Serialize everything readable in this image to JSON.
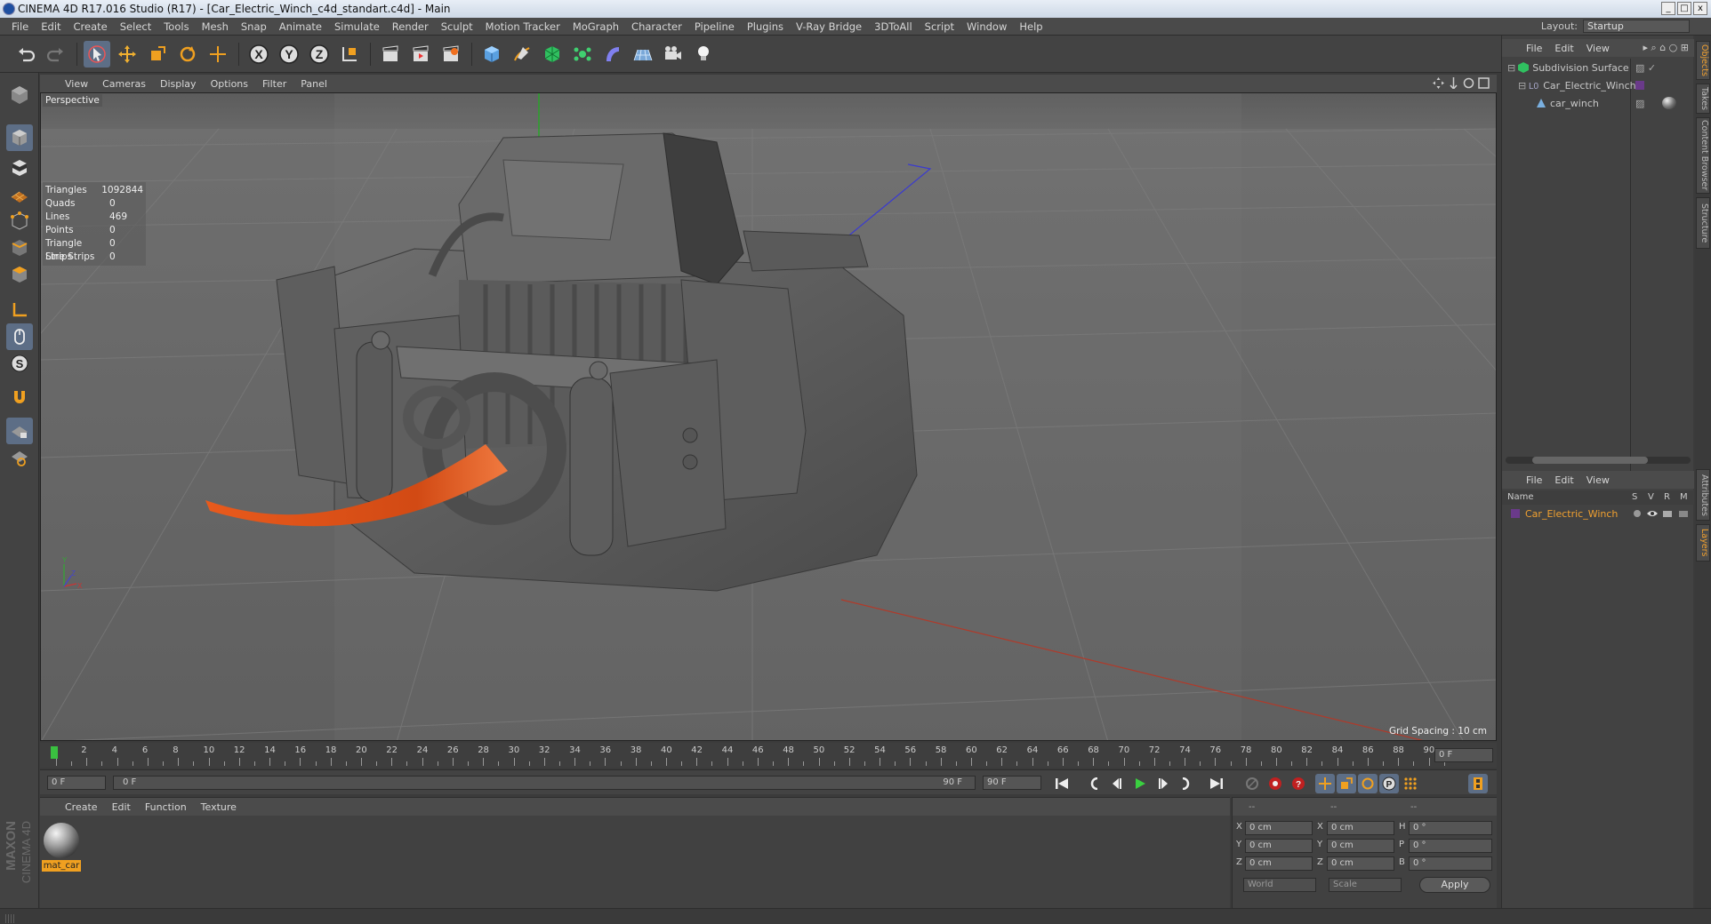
{
  "window": {
    "title": "CINEMA 4D R17.016 Studio (R17) - [Car_Electric_Winch_c4d_standart.c4d] - Main",
    "min": "_",
    "max": "□",
    "close": "x"
  },
  "menu": [
    "File",
    "Edit",
    "Create",
    "Select",
    "Tools",
    "Mesh",
    "Snap",
    "Animate",
    "Simulate",
    "Render",
    "Sculpt",
    "Motion Tracker",
    "MoGraph",
    "Character",
    "Pipeline",
    "Plugins",
    "V-Ray Bridge",
    "3DToAll",
    "Script",
    "Window",
    "Help"
  ],
  "layout": {
    "label": "Layout:",
    "value": "Startup"
  },
  "viewport": {
    "menu": [
      "View",
      "Cameras",
      "Display",
      "Options",
      "Filter",
      "Panel"
    ],
    "label": "Perspective",
    "grid_spacing": "Grid Spacing : 10 cm",
    "stats": [
      {
        "k": "Triangles",
        "v": "1092844"
      },
      {
        "k": "Quads",
        "v": "0"
      },
      {
        "k": "Lines",
        "v": "469"
      },
      {
        "k": "Points",
        "v": "0"
      },
      {
        "k": "Triangle Strips",
        "v": "0"
      },
      {
        "k": "Line Strips",
        "v": "0"
      }
    ]
  },
  "timeline": {
    "ticks": [
      "0",
      "2",
      "4",
      "6",
      "8",
      "10",
      "12",
      "14",
      "16",
      "18",
      "20",
      "22",
      "24",
      "26",
      "28",
      "30",
      "32",
      "34",
      "36",
      "38",
      "40",
      "42",
      "44",
      "46",
      "48",
      "50",
      "52",
      "54",
      "56",
      "58",
      "60",
      "62",
      "64",
      "66",
      "68",
      "70",
      "72",
      "74",
      "76",
      "78",
      "80",
      "82",
      "84",
      "86",
      "88",
      "90"
    ],
    "current": "0 F"
  },
  "transport": {
    "start": "0 F",
    "range_start": "0 F",
    "range_end": "90 F",
    "end": "90 F"
  },
  "material_manager": {
    "menu": [
      "Create",
      "Edit",
      "Function",
      "Texture"
    ],
    "materials": [
      {
        "name": "mat_car"
      }
    ]
  },
  "coords": {
    "headers": [
      "--",
      "--",
      "--"
    ],
    "rows": [
      {
        "a": "X",
        "av": "0 cm",
        "b": "X",
        "bv": "0 cm",
        "c": "H",
        "cv": "0 °"
      },
      {
        "a": "Y",
        "av": "0 cm",
        "b": "Y",
        "bv": "0 cm",
        "c": "P",
        "cv": "0 °"
      },
      {
        "a": "Z",
        "av": "0 cm",
        "b": "Z",
        "bv": "0 cm",
        "c": "B",
        "cv": "0 °"
      }
    ],
    "world": "World",
    "scale": "Scale",
    "apply": "Apply"
  },
  "object_manager": {
    "menu": [
      "File",
      "Edit",
      "View"
    ],
    "objects": [
      {
        "name": "Subdivision Surface"
      },
      {
        "name": "Car_Electric_Winch"
      },
      {
        "name": "car_winch"
      }
    ]
  },
  "layer_manager": {
    "menu": [
      "File",
      "Edit",
      "View"
    ],
    "cols": {
      "name": "Name",
      "s": "S",
      "v": "V",
      "r": "R",
      "m": "M"
    },
    "layers": [
      {
        "name": "Car_Electric_Winch"
      }
    ]
  },
  "side_tabs": [
    "Objects",
    "Takes",
    "Content Browser",
    "Structure",
    "Attributes",
    "Layers"
  ],
  "brand": {
    "line1": "MAXON",
    "line2": "CINEMA 4D"
  },
  "colors": {
    "accent": "#f0a030",
    "selected": "#5d6e86",
    "strap": "#d9531c"
  }
}
